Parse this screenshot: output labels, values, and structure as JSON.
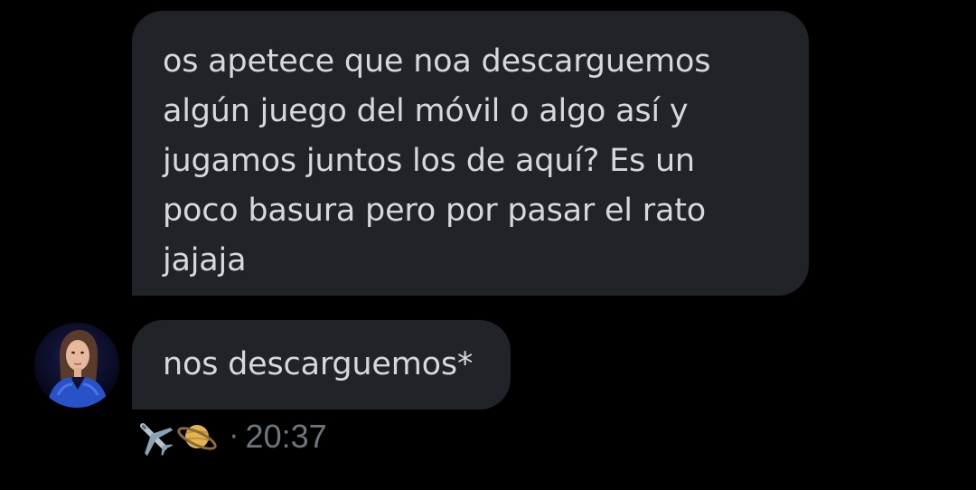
{
  "messages": [
    {
      "text": "os apetece que noa descarguemos\nalgún juego del móvil o algo así y\njugamos juntos los de aquí? Es un\npoco basura pero por pasar el rato\njajaja"
    },
    {
      "text": "nos descarguemos*"
    }
  ],
  "meta": {
    "emoji_icons": [
      "airplane-icon",
      "ringed-planet-icon"
    ],
    "separator": "·",
    "time": "20:37"
  },
  "colors": {
    "background": "#000000",
    "bubble": "#202327",
    "text": "#d6d8da",
    "meta_text": "#6e767d"
  }
}
